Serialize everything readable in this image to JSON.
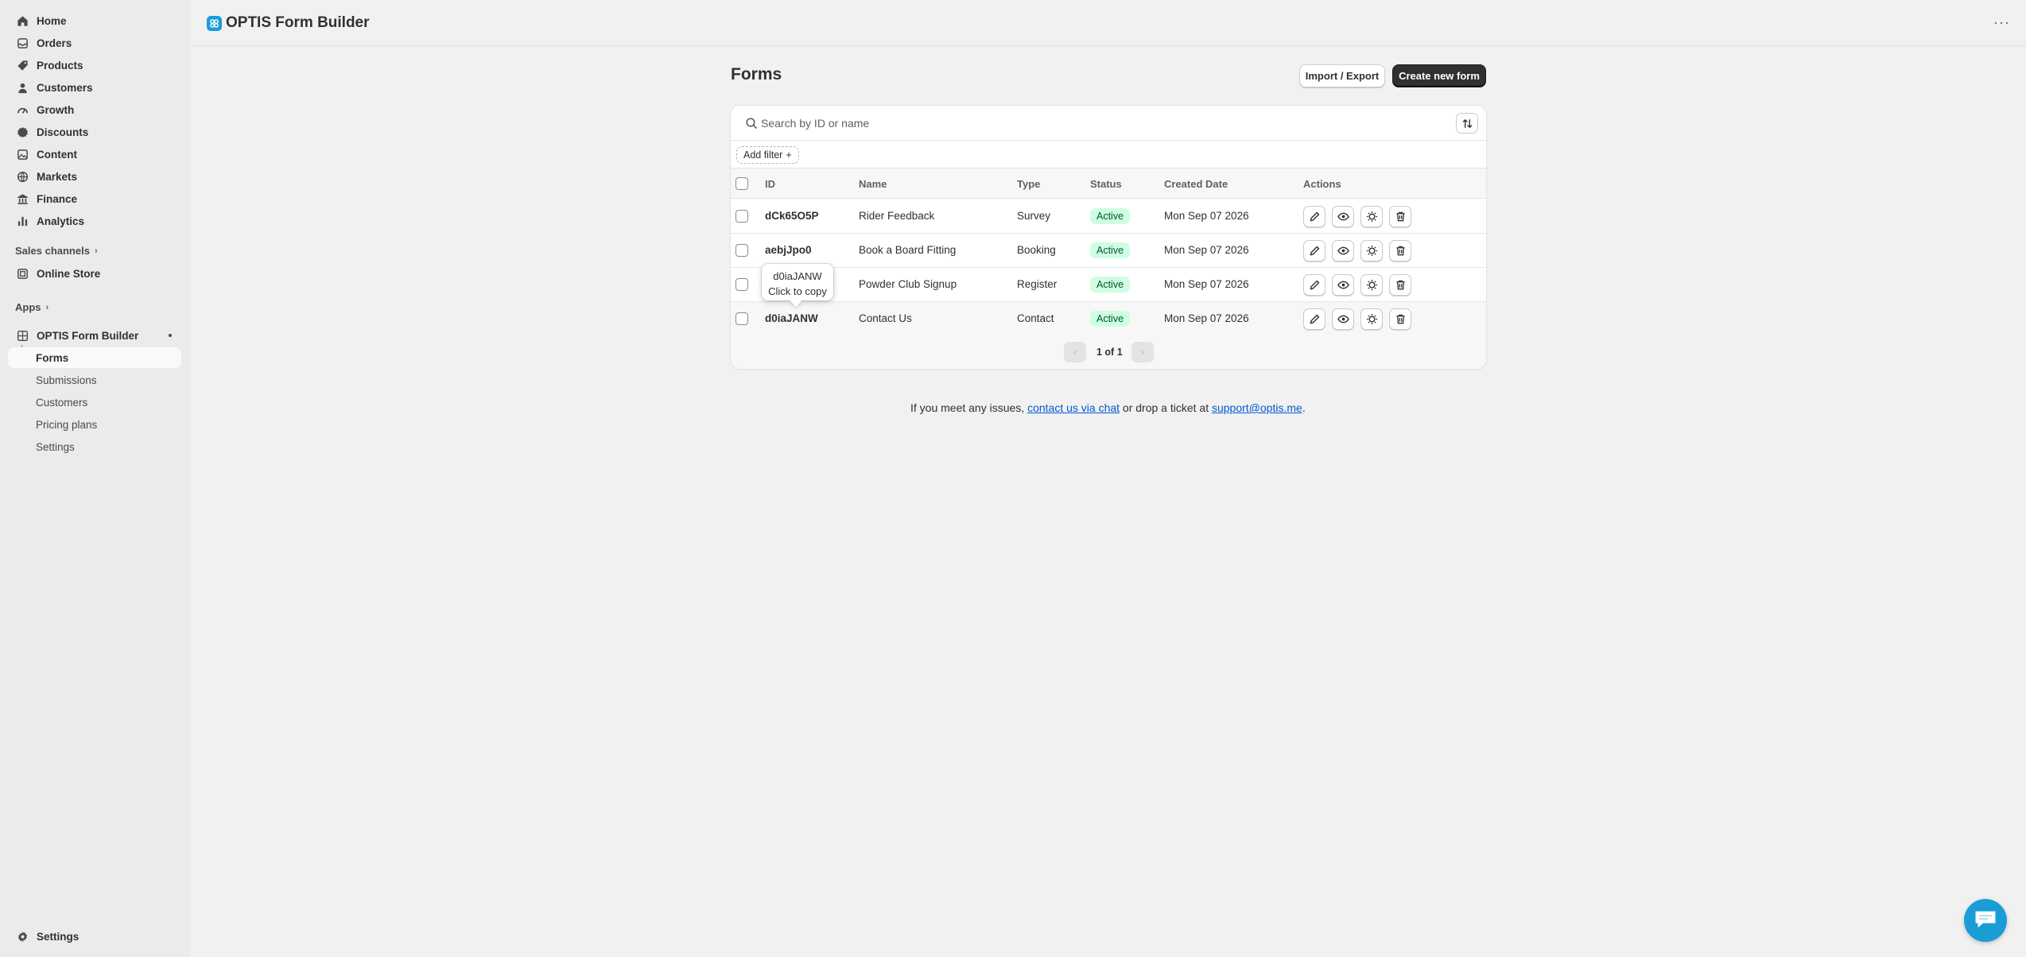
{
  "sidebar": {
    "nav": [
      {
        "label": "Home",
        "icon": "home-icon"
      },
      {
        "label": "Orders",
        "icon": "inbox-icon"
      },
      {
        "label": "Products",
        "icon": "tag-icon"
      },
      {
        "label": "Customers",
        "icon": "person-icon"
      },
      {
        "label": "Growth",
        "icon": "gauge-icon"
      },
      {
        "label": "Discounts",
        "icon": "discount-icon"
      },
      {
        "label": "Content",
        "icon": "image-icon"
      },
      {
        "label": "Markets",
        "icon": "globe-icon"
      },
      {
        "label": "Finance",
        "icon": "bank-icon"
      },
      {
        "label": "Analytics",
        "icon": "bar-chart-icon"
      }
    ],
    "sales_channels_label": "Sales channels",
    "online_store_label": "Online Store",
    "apps_label": "Apps",
    "app_name": "OPTIS Form Builder",
    "app_subitems": [
      "Forms",
      "Submissions",
      "Customers",
      "Pricing plans",
      "Settings"
    ],
    "settings_label": "Settings"
  },
  "header": {
    "title": "OPTIS Form Builder",
    "more_label": "···"
  },
  "page": {
    "title": "Forms",
    "import_export_label": "Import / Export",
    "create_label": "Create new form"
  },
  "search": {
    "placeholder": "Search by ID or name"
  },
  "filter": {
    "add_label": "Add filter",
    "plus": "+"
  },
  "table": {
    "columns": [
      "ID",
      "Name",
      "Type",
      "Status",
      "Created Date",
      "Actions"
    ],
    "rows": [
      {
        "id": "dCk65O5P",
        "name": "Rider Feedback",
        "type": "Survey",
        "status": "Active",
        "created": "Mon Sep 07 2026"
      },
      {
        "id": "aebjJpo0",
        "name": "Book a Board Fitting",
        "type": "Booking",
        "status": "Active",
        "created": "Mon Sep 07 2026"
      },
      {
        "id": "",
        "name": "Powder Club Signup",
        "type": "Register",
        "status": "Active",
        "created": "Mon Sep 07 2026"
      },
      {
        "id": "d0iaJANW",
        "name": "Contact Us",
        "type": "Contact",
        "status": "Active",
        "created": "Mon Sep 07 2026"
      }
    ]
  },
  "tooltip": {
    "line1": "d0iaJANW",
    "line2": "Click to copy"
  },
  "pagination": {
    "text": "1 of 1",
    "prev": "‹",
    "next": "›"
  },
  "support": {
    "prefix": "If you meet any issues,",
    "chat_link": "contact us via chat",
    "middle": "or drop a ticket at",
    "email_link": "support@optis.me",
    "suffix": "."
  },
  "colors": {
    "accent": "#1a9dd6",
    "primary_button": "#303030",
    "badge_bg": "#cdfee1",
    "badge_text": "#0c5132",
    "link": "#005bd3"
  }
}
